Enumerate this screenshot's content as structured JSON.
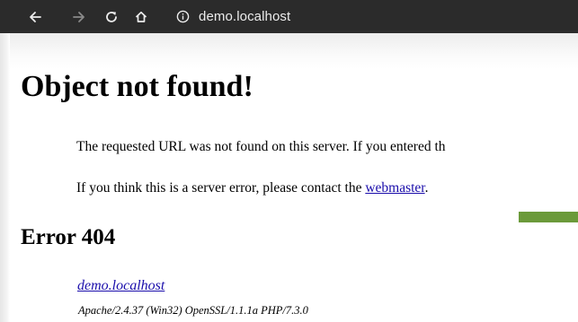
{
  "browser": {
    "url": "demo.localhost",
    "back_icon": "arrow-left",
    "forward_icon": "arrow-right",
    "reload_icon": "reload",
    "home_icon": "home",
    "info_icon": "info"
  },
  "page": {
    "title": "Object not found!",
    "paragraph1": "The requested URL was not found on this server. If you entered th",
    "paragraph2_prefix": "If you think this is a server error, please contact the ",
    "paragraph2_link": "webmaster",
    "paragraph2_suffix": ".",
    "error_heading": "Error 404",
    "host_link": "demo.localhost",
    "server_signature": "Apache/2.4.37 (Win32) OpenSSL/1.1.1a PHP/7.3.0"
  },
  "colors": {
    "toolbar_bg": "#2b2b2b",
    "link": "#1a0dab",
    "accent_bar": "#6b9a3a"
  }
}
